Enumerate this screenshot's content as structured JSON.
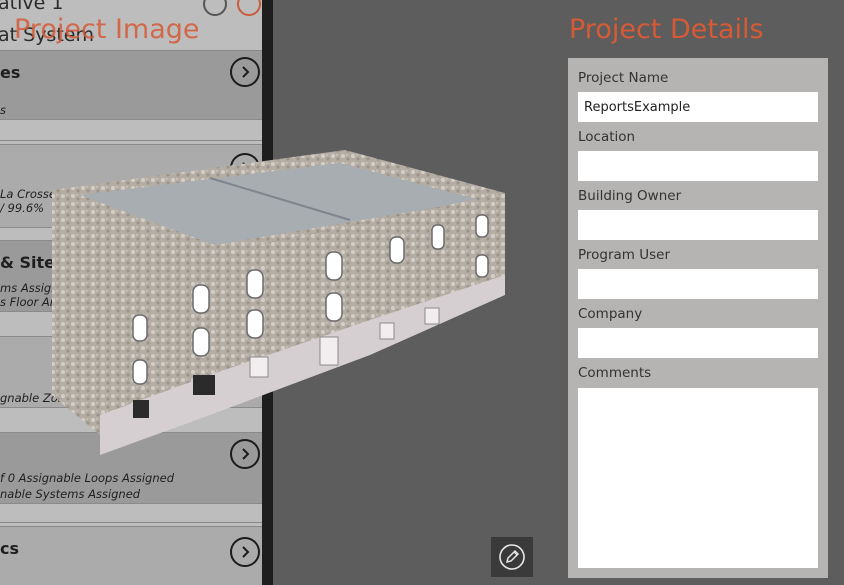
{
  "left_panel": {
    "header_partial_1": "ative 1",
    "header_partial_2": "at System",
    "cards": [
      {
        "title": "es",
        "lines": [
          "s"
        ]
      },
      {
        "title": "",
        "lines": [
          "La Crosse Mun...",
          "/ 99.6%"
        ]
      },
      {
        "title": "& Site",
        "lines": [
          "ms Assigned",
          "s Floor Area"
        ]
      },
      {
        "title": "",
        "lines": [
          "gnable Zones Assig..."
        ]
      },
      {
        "title": "",
        "lines": [
          "f 0 Assignable Loops Assigned",
          "nable Systems Assigned"
        ]
      },
      {
        "title": "cs",
        "lines": []
      }
    ]
  },
  "project_image": {
    "title": "Project Image"
  },
  "project_details": {
    "title": "Project Details",
    "fields": {
      "project_name": {
        "label": "Project Name",
        "value": "ReportsExample"
      },
      "location": {
        "label": "Location",
        "value": ""
      },
      "building_owner": {
        "label": "Building Owner",
        "value": ""
      },
      "program_user": {
        "label": "Program User",
        "value": ""
      },
      "company": {
        "label": "Company",
        "value": ""
      },
      "comments": {
        "label": "Comments",
        "value": ""
      }
    }
  },
  "icons": {
    "arrow": "chevron-right-circle-icon",
    "edit": "pencil-icon"
  },
  "colors": {
    "accent": "#d65a36",
    "background": "#5d5d5d",
    "details_panel": "#b5b4b2",
    "left_panel": "#bdbdbd"
  }
}
